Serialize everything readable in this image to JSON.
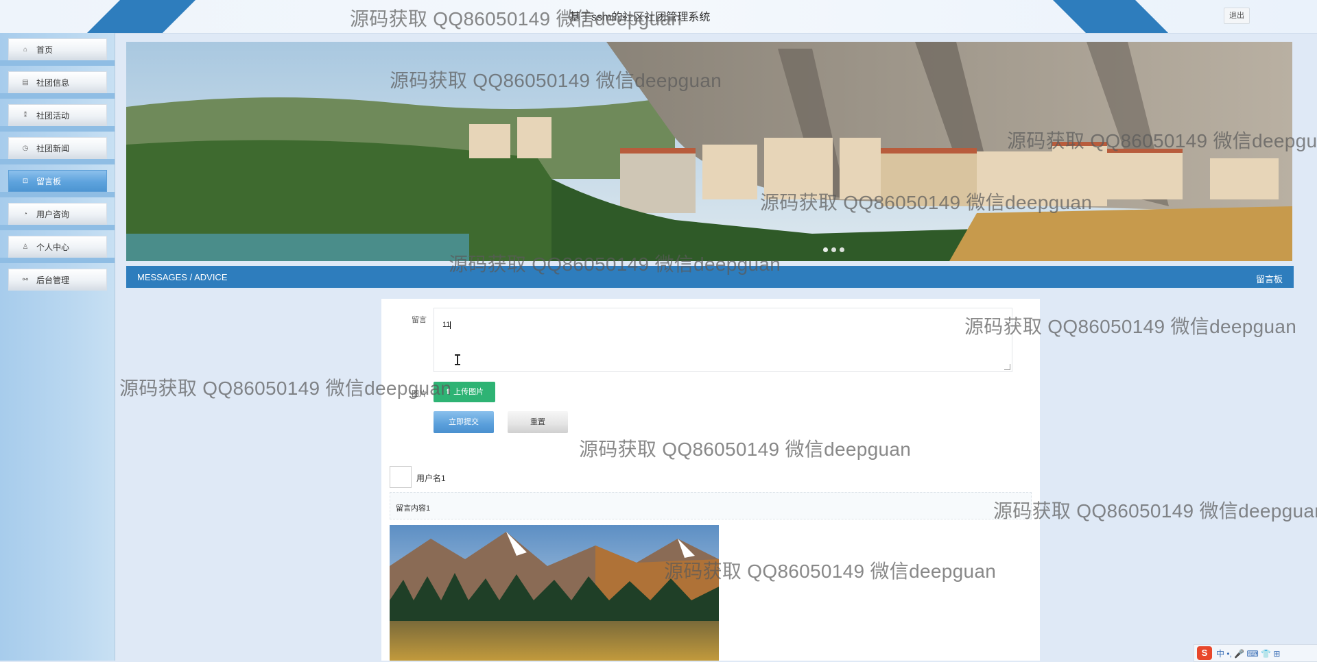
{
  "header": {
    "title": "基于ssm的社区社团管理系统",
    "logout_label": "退出"
  },
  "sidebar": {
    "items": [
      {
        "label": "首页",
        "icon": "home-icon"
      },
      {
        "label": "社团信息",
        "icon": "list-icon"
      },
      {
        "label": "社团活动",
        "icon": "activity-icon"
      },
      {
        "label": "社团新闻",
        "icon": "clock-icon"
      },
      {
        "label": "留言板",
        "icon": "message-icon",
        "active": true
      },
      {
        "label": "用户咨询",
        "icon": "chat-icon"
      },
      {
        "label": "个人中心",
        "icon": "user-icon"
      },
      {
        "label": "后台管理",
        "icon": "link-icon"
      }
    ]
  },
  "section": {
    "title_en": "MESSAGES / ADVICE",
    "title_cn": "留言板"
  },
  "form": {
    "message_label": "留言",
    "message_value": "11",
    "image_label": "图片",
    "upload_label": "上传图片",
    "submit_label": "立即提交",
    "reset_label": "重置"
  },
  "comments": [
    {
      "username": "用户名1",
      "content": "留言内容1"
    }
  ],
  "watermark_text": "源码获取 QQ86050149 微信deepguan",
  "ime": {
    "label": "中 •, 🎤 ⌨ 👕 ⊞"
  },
  "colors": {
    "primary": "#2e7dbd",
    "upload_green": "#2eb374",
    "active_nav": "#5ea3dd"
  }
}
